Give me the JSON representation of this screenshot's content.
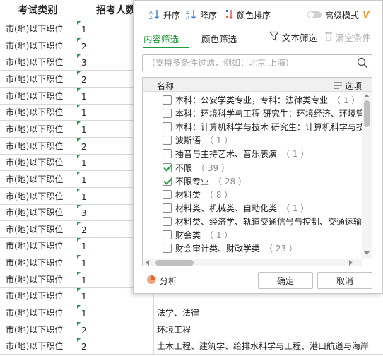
{
  "sheet": {
    "col_headers": [
      "考试类别",
      "招考人数"
    ],
    "rows": [
      {
        "category": "市(地)以下职位",
        "count": "1",
        "major": ""
      },
      {
        "category": "市(地)以下职位",
        "count": "2",
        "major": ""
      },
      {
        "category": "市(地)以下职位",
        "count": "3",
        "major": ""
      },
      {
        "category": "市(地)以下职位",
        "count": "2",
        "major": ""
      },
      {
        "category": "市(地)以下职位",
        "count": "1",
        "major": ""
      },
      {
        "category": "市(地)以下职位",
        "count": "1",
        "major": ""
      },
      {
        "category": "市(地)以下职位",
        "count": "1",
        "major": ""
      },
      {
        "category": "市(地)以下职位",
        "count": "2",
        "major": ""
      },
      {
        "category": "市(地)以下职位",
        "count": "1",
        "major": ""
      },
      {
        "category": "市(地)以下职位",
        "count": "1",
        "major": ""
      },
      {
        "category": "市(地)以下职位",
        "count": "1",
        "major": ""
      },
      {
        "category": "市(地)以下职位",
        "count": "3",
        "major": ""
      },
      {
        "category": "市(地)以下职位",
        "count": "2",
        "major": ""
      },
      {
        "category": "市(地)以下职位",
        "count": "1",
        "major": ""
      },
      {
        "category": "市(地)以下职位",
        "count": "1",
        "major": ""
      },
      {
        "category": "市(地)以下职位",
        "count": "1",
        "major": ""
      },
      {
        "category": "市(地)以下职位",
        "count": "1",
        "major": ""
      },
      {
        "category": "市(地)以下职位",
        "count": "1",
        "major": "法学、法律"
      },
      {
        "category": "市(地)以下职位",
        "count": "2",
        "major": "环境工程"
      },
      {
        "category": "市(地)以下职位",
        "count": "2",
        "major": "土木工程、建筑学、给排水科学与工程、港口航道与海岸"
      }
    ]
  },
  "popup": {
    "toolbar": {
      "sort_asc": "升序",
      "sort_desc": "降序",
      "color_sort": "颜色排序",
      "advanced_mode": "高级模式",
      "advanced_badge": "V"
    },
    "tabs": {
      "content": "内容筛选",
      "color": "颜色筛选",
      "text_filter": "文本筛选",
      "clear": "清空条件"
    },
    "search": {
      "placeholder": "（支持多条件过滤，例如：北京 上海）"
    },
    "list_header": {
      "name": "名称",
      "options": "选项"
    },
    "items": [
      {
        "label": "本科：公安学类专业，专科：法律类专业",
        "count": "（ 1 ）",
        "checked": false
      },
      {
        "label": "本科：环境科学与工程 研究生：环境经济、环境管理",
        "count": "",
        "checked": false
      },
      {
        "label": "本科：计算机科学与技术 研究生：计算机科学与技术",
        "count": "",
        "checked": false
      },
      {
        "label": "波斯语",
        "count": "（ 1 ）",
        "checked": false
      },
      {
        "label": "播音与主持艺术、音乐表演",
        "count": "（ 1 ）",
        "checked": false
      },
      {
        "label": "不限",
        "count": "（ 39 ）",
        "checked": true
      },
      {
        "label": "不限专业",
        "count": "（ 28 ）",
        "checked": true
      },
      {
        "label": "材料类",
        "count": "（ 8 ）",
        "checked": false
      },
      {
        "label": "材料类、机械类、自动化类",
        "count": "（ 1 ）",
        "checked": false
      },
      {
        "label": "材料类、经济学、轨道交通信号与控制、交通运输",
        "count": "",
        "checked": false
      },
      {
        "label": "财会类",
        "count": "（ 1 ）",
        "checked": false
      },
      {
        "label": "财会审计类、财政学类",
        "count": "（ 23 ）",
        "checked": false
      }
    ],
    "footer": {
      "analysis": "分析",
      "ok": "确定",
      "cancel": "取消"
    },
    "colors": {
      "accent": "#1f9a3d",
      "pie": "#e8622a",
      "advanced_badge": "#e9a23b"
    }
  }
}
